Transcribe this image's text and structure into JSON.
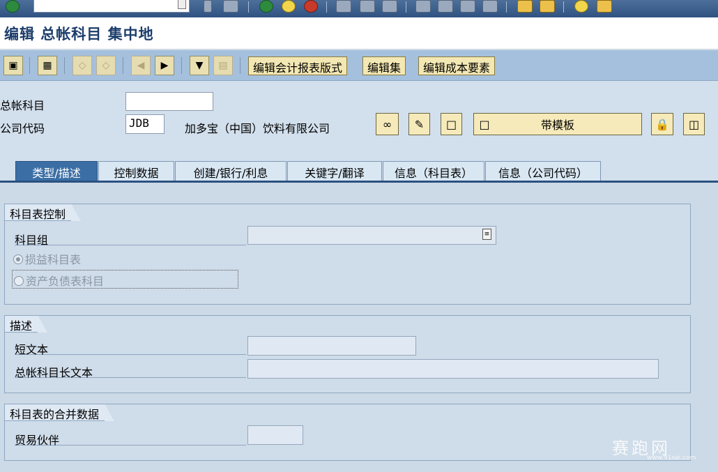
{
  "title": "编辑 总帐科目 集中地",
  "app_toolbar": {
    "buttons": [
      "编辑会计报表版式",
      "编辑集",
      "编辑成本要素"
    ]
  },
  "header": {
    "gl_account_label": "总帐科目",
    "gl_account_value": "",
    "company_code_label": "公司代码",
    "company_code_value": "JDB",
    "company_name": "加多宝（中国）饮料有限公司",
    "template_button": "带模板"
  },
  "tabs": [
    "类型/描述",
    "控制数据",
    "创建/银行/利息",
    "关键字/翻译",
    "信息（科目表）",
    "信息（公司代码）"
  ],
  "active_tab": "类型/描述",
  "groups": {
    "coa_control": {
      "title": "科目表控制",
      "account_group_label": "科目组",
      "account_group_value": "",
      "radio_pl": "损益科目表",
      "radio_bs": "资产负债表科目"
    },
    "description": {
      "title": "描述",
      "short_text_label": "短文本",
      "short_text_value": "",
      "long_text_label": "总帐科目长文本",
      "long_text_value": ""
    },
    "consolidation": {
      "title": "科目表的合并数据",
      "trading_partner_label": "贸易伙伴",
      "trading_partner_value": ""
    }
  },
  "watermark": {
    "text": "赛跑网",
    "url": "www.91sai.com"
  }
}
